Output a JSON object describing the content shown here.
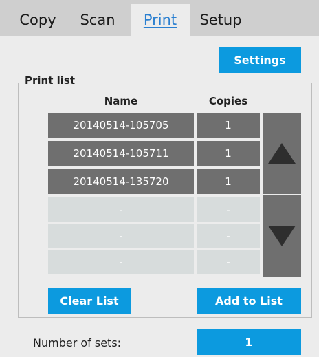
{
  "tabs": [
    {
      "label": "Copy"
    },
    {
      "label": "Scan"
    },
    {
      "label": "Print"
    },
    {
      "label": "Setup"
    }
  ],
  "settings_label": "Settings",
  "print_list": {
    "legend": "Print list",
    "headers": {
      "name": "Name",
      "copies": "Copies"
    },
    "rows": [
      {
        "name": "20140514-105705",
        "copies": "1"
      },
      {
        "name": "20140514-105711",
        "copies": "1"
      },
      {
        "name": "20140514-135720",
        "copies": "1"
      },
      {
        "name": "-",
        "copies": "-"
      },
      {
        "name": "-",
        "copies": "-"
      },
      {
        "name": "-",
        "copies": "-"
      }
    ]
  },
  "buttons": {
    "clear_list": "Clear List",
    "add_to_list": "Add to List"
  },
  "sets": {
    "label": "Number of sets:",
    "value": "1"
  },
  "icons": {
    "scroll_up": "triangle-up-icon",
    "scroll_down": "triangle-down-icon"
  },
  "colors": {
    "accent": "#0c9adf",
    "active_tab_text": "#2a7fd0",
    "row_filled": "#6f6f6f",
    "row_empty": "#d7dcdc"
  }
}
